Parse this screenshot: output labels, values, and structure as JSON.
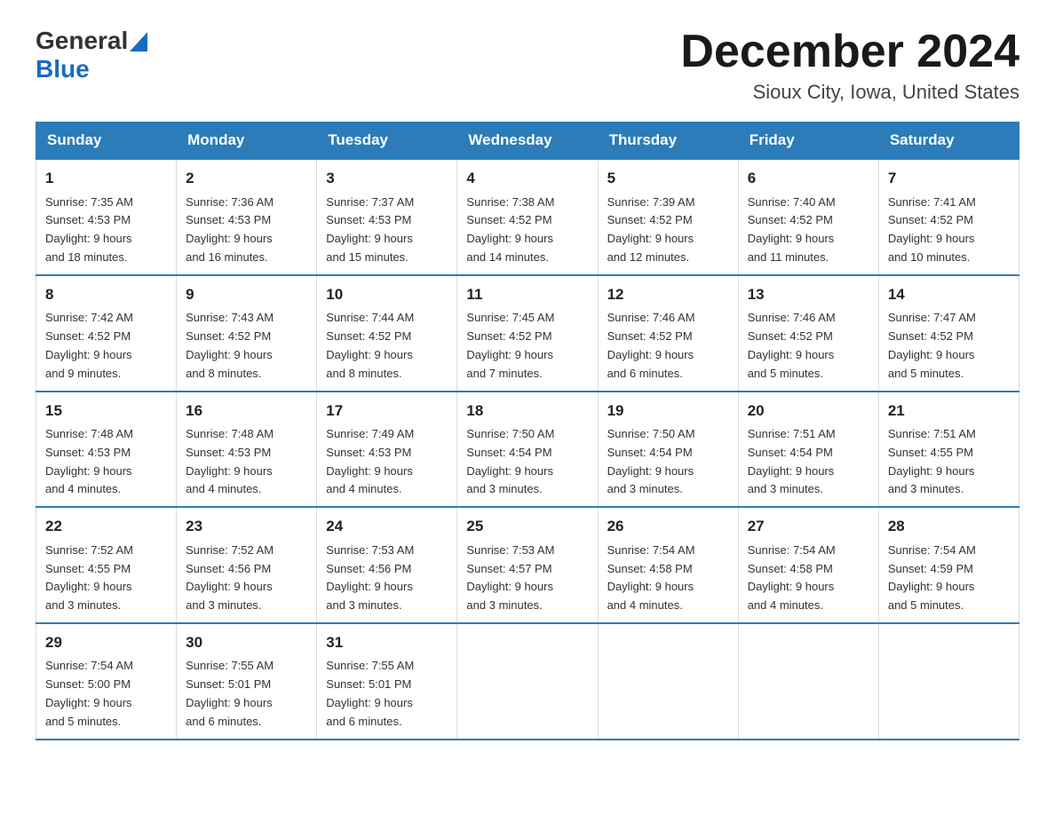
{
  "header": {
    "logo_general": "General",
    "logo_blue": "Blue",
    "title": "December 2024",
    "subtitle": "Sioux City, Iowa, United States"
  },
  "days_of_week": [
    "Sunday",
    "Monday",
    "Tuesday",
    "Wednesday",
    "Thursday",
    "Friday",
    "Saturday"
  ],
  "weeks": [
    [
      {
        "day": "1",
        "sunrise": "7:35 AM",
        "sunset": "4:53 PM",
        "daylight": "9 hours and 18 minutes."
      },
      {
        "day": "2",
        "sunrise": "7:36 AM",
        "sunset": "4:53 PM",
        "daylight": "9 hours and 16 minutes."
      },
      {
        "day": "3",
        "sunrise": "7:37 AM",
        "sunset": "4:53 PM",
        "daylight": "9 hours and 15 minutes."
      },
      {
        "day": "4",
        "sunrise": "7:38 AM",
        "sunset": "4:52 PM",
        "daylight": "9 hours and 14 minutes."
      },
      {
        "day": "5",
        "sunrise": "7:39 AM",
        "sunset": "4:52 PM",
        "daylight": "9 hours and 12 minutes."
      },
      {
        "day": "6",
        "sunrise": "7:40 AM",
        "sunset": "4:52 PM",
        "daylight": "9 hours and 11 minutes."
      },
      {
        "day": "7",
        "sunrise": "7:41 AM",
        "sunset": "4:52 PM",
        "daylight": "9 hours and 10 minutes."
      }
    ],
    [
      {
        "day": "8",
        "sunrise": "7:42 AM",
        "sunset": "4:52 PM",
        "daylight": "9 hours and 9 minutes."
      },
      {
        "day": "9",
        "sunrise": "7:43 AM",
        "sunset": "4:52 PM",
        "daylight": "9 hours and 8 minutes."
      },
      {
        "day": "10",
        "sunrise": "7:44 AM",
        "sunset": "4:52 PM",
        "daylight": "9 hours and 8 minutes."
      },
      {
        "day": "11",
        "sunrise": "7:45 AM",
        "sunset": "4:52 PM",
        "daylight": "9 hours and 7 minutes."
      },
      {
        "day": "12",
        "sunrise": "7:46 AM",
        "sunset": "4:52 PM",
        "daylight": "9 hours and 6 minutes."
      },
      {
        "day": "13",
        "sunrise": "7:46 AM",
        "sunset": "4:52 PM",
        "daylight": "9 hours and 5 minutes."
      },
      {
        "day": "14",
        "sunrise": "7:47 AM",
        "sunset": "4:52 PM",
        "daylight": "9 hours and 5 minutes."
      }
    ],
    [
      {
        "day": "15",
        "sunrise": "7:48 AM",
        "sunset": "4:53 PM",
        "daylight": "9 hours and 4 minutes."
      },
      {
        "day": "16",
        "sunrise": "7:48 AM",
        "sunset": "4:53 PM",
        "daylight": "9 hours and 4 minutes."
      },
      {
        "day": "17",
        "sunrise": "7:49 AM",
        "sunset": "4:53 PM",
        "daylight": "9 hours and 4 minutes."
      },
      {
        "day": "18",
        "sunrise": "7:50 AM",
        "sunset": "4:54 PM",
        "daylight": "9 hours and 3 minutes."
      },
      {
        "day": "19",
        "sunrise": "7:50 AM",
        "sunset": "4:54 PM",
        "daylight": "9 hours and 3 minutes."
      },
      {
        "day": "20",
        "sunrise": "7:51 AM",
        "sunset": "4:54 PM",
        "daylight": "9 hours and 3 minutes."
      },
      {
        "day": "21",
        "sunrise": "7:51 AM",
        "sunset": "4:55 PM",
        "daylight": "9 hours and 3 minutes."
      }
    ],
    [
      {
        "day": "22",
        "sunrise": "7:52 AM",
        "sunset": "4:55 PM",
        "daylight": "9 hours and 3 minutes."
      },
      {
        "day": "23",
        "sunrise": "7:52 AM",
        "sunset": "4:56 PM",
        "daylight": "9 hours and 3 minutes."
      },
      {
        "day": "24",
        "sunrise": "7:53 AM",
        "sunset": "4:56 PM",
        "daylight": "9 hours and 3 minutes."
      },
      {
        "day": "25",
        "sunrise": "7:53 AM",
        "sunset": "4:57 PM",
        "daylight": "9 hours and 3 minutes."
      },
      {
        "day": "26",
        "sunrise": "7:54 AM",
        "sunset": "4:58 PM",
        "daylight": "9 hours and 4 minutes."
      },
      {
        "day": "27",
        "sunrise": "7:54 AM",
        "sunset": "4:58 PM",
        "daylight": "9 hours and 4 minutes."
      },
      {
        "day": "28",
        "sunrise": "7:54 AM",
        "sunset": "4:59 PM",
        "daylight": "9 hours and 5 minutes."
      }
    ],
    [
      {
        "day": "29",
        "sunrise": "7:54 AM",
        "sunset": "5:00 PM",
        "daylight": "9 hours and 5 minutes."
      },
      {
        "day": "30",
        "sunrise": "7:55 AM",
        "sunset": "5:01 PM",
        "daylight": "9 hours and 6 minutes."
      },
      {
        "day": "31",
        "sunrise": "7:55 AM",
        "sunset": "5:01 PM",
        "daylight": "9 hours and 6 minutes."
      },
      null,
      null,
      null,
      null
    ]
  ],
  "labels": {
    "sunrise": "Sunrise:",
    "sunset": "Sunset:",
    "daylight": "Daylight:"
  }
}
